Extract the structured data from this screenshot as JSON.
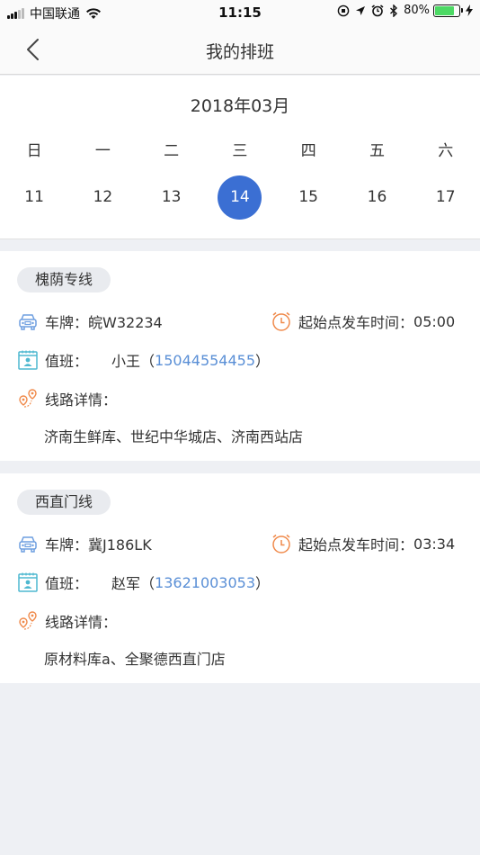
{
  "status_bar": {
    "carrier": "中国联通",
    "time": "11:15",
    "battery": "80%",
    "battery_level": 0.8
  },
  "nav": {
    "title": "我的排班"
  },
  "calendar": {
    "month": "2018年03月",
    "weekdays": [
      "日",
      "一",
      "二",
      "三",
      "四",
      "五",
      "六"
    ],
    "days": [
      "11",
      "12",
      "13",
      "14",
      "15",
      "16",
      "17"
    ],
    "selected_day": "14"
  },
  "schedules": [
    {
      "route": "槐荫专线",
      "plate_label": "车牌：",
      "plate": "皖W32234",
      "time_label": "起始点发车时间：",
      "time": "05:00",
      "duty_label": "值班：",
      "duty_name": "小王",
      "duty_phone": "15044554455",
      "route_label": "线路详情：",
      "stops": "济南生鲜库、世纪中华城店、济南西站店"
    },
    {
      "route": "西直门线",
      "plate_label": "车牌：",
      "plate": "冀J186LK",
      "time_label": "起始点发车时间：",
      "time": "03:34",
      "duty_label": "值班：",
      "duty_name": "赵军",
      "duty_phone": "13621003053",
      "route_label": "线路详情：",
      "stops": "原材料库a、全聚德西直门店"
    }
  ],
  "colors": {
    "accent": "#3b6fd3",
    "phone": "#5a8fd6",
    "icon_blue": "#6f9fe0",
    "icon_orange": "#f08a4b",
    "icon_teal": "#4fb8d0"
  }
}
